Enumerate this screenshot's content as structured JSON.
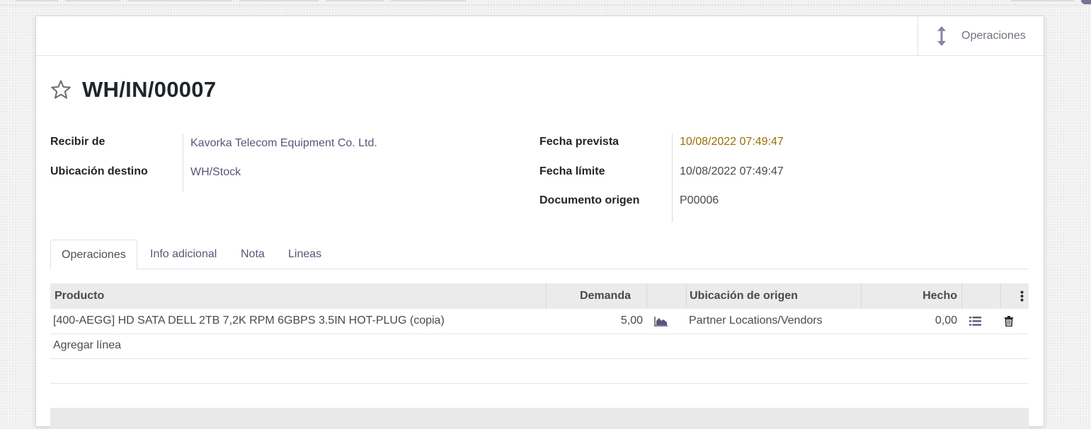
{
  "app": {
    "accent_color": "#5c5479",
    "warning_color": "#9a6e00"
  },
  "smart_button": {
    "label": "Operaciones",
    "icon": "arrows-vertical-icon"
  },
  "record": {
    "title": "WH/IN/00007",
    "star_icon": "star-outline-icon"
  },
  "fields_left": [
    {
      "label": "Recibir de",
      "value": "Kavorka Telecom Equipment Co. Ltd."
    },
    {
      "label": "Ubicación destino",
      "value": "WH/Stock"
    }
  ],
  "fields_right": [
    {
      "label": "Fecha prevista",
      "value": "10/08/2022 07:49:47"
    },
    {
      "label": "Fecha límite",
      "value": "10/08/2022 07:49:47"
    },
    {
      "label": "Documento origen",
      "value": "P00006"
    }
  ],
  "tabs": [
    {
      "label": "Operaciones",
      "active": true
    },
    {
      "label": "Info adicional",
      "active": false
    },
    {
      "label": "Nota",
      "active": false
    },
    {
      "label": "Lineas",
      "active": false
    }
  ],
  "table": {
    "columns": [
      "Producto",
      "Demanda",
      "Ubicación de origen",
      "Hecho"
    ],
    "rows": [
      {
        "producto": "[400-AEGG] HD SATA DELL 2TB 7,2K RPM 6GBPS 3.5IN HOT-PLUG (copia)",
        "demanda": "5,00",
        "forecast_icon": "area-chart-icon",
        "ubicacion": "Partner Locations/Vendors",
        "hecho": "0,00",
        "detail_icon": "list-icon",
        "delete_icon": "trash-icon"
      }
    ],
    "add_line": "Agregar línea",
    "options_icon": "vertical-dots-icon"
  }
}
